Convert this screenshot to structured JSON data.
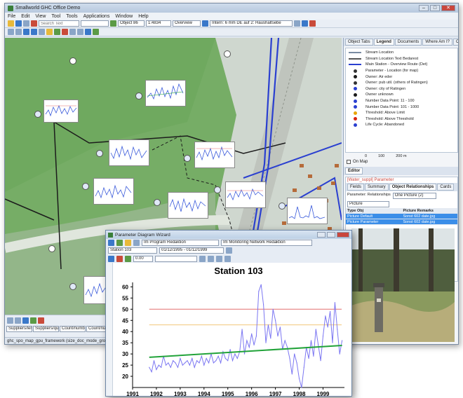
{
  "window": {
    "title": "Smallworld GHC Office Demo",
    "menu": [
      "File",
      "Edit",
      "View",
      "Tool",
      "Tools",
      "Applications",
      "Window",
      "Help"
    ],
    "search_placeholder": "Search Text",
    "combo_object": "Object 86",
    "combo_scale": "1:4834",
    "combo_mode": "Overview",
    "combo_trail": "Intern: 6 mm DE auf 2: Haushaltsebe"
  },
  "right_panel": {
    "tabs": [
      "Object Tabs",
      "Legend",
      "Documents",
      "Where Am I?",
      "CAD Tools"
    ],
    "legend_items": [
      {
        "label": "Stream Location",
        "color": "#7a8ca3",
        "shape": "line"
      },
      {
        "label": "Stream Location Text Bedarest",
        "color": "#555555",
        "shape": "line"
      },
      {
        "label": "Main Station - Overview Route (Det)",
        "color": "#2a3fd0",
        "shape": "line"
      },
      {
        "label": "Parameter - Location (for map)",
        "color": "#333333",
        "shape": "dot"
      },
      {
        "label": "Owner: Air eder",
        "color": "#1a1a1a",
        "shape": "dot"
      },
      {
        "label": "Owner: pub util. (others of Ratingen)",
        "color": "#333333",
        "shape": "dot"
      },
      {
        "label": "Owner: city of Ratingen",
        "color": "#2a3fd0",
        "shape": "dot"
      },
      {
        "label": "Owner unknown",
        "color": "#1a1a1a",
        "shape": "dot"
      },
      {
        "label": "Number Data Point: 11 - 100",
        "color": "#2a3fd0",
        "shape": "dot"
      },
      {
        "label": "Number Data Point: 101 - 1000",
        "color": "#2a3fd0",
        "shape": "dot"
      },
      {
        "label": "Threshold: Above Limit",
        "color": "#e8a400",
        "shape": "dot"
      },
      {
        "label": "Threshold: Above Threshold",
        "color": "#d9230f",
        "shape": "dot"
      },
      {
        "label": "Life Cycle: Abandoned",
        "color": "#2a3fd0",
        "shape": "dot"
      }
    ],
    "scale_bar": [
      "0",
      "100",
      "200 m"
    ],
    "on_map_label": "On Map",
    "editor_tab": "Editor",
    "editor_title": "[Water_suppl] Parameter",
    "editor_subtabs": [
      "Fields",
      "Summary",
      "Object Relationships",
      "Cards"
    ],
    "relationship_label": "Parameter: Relationships",
    "relationship_value": "One Picture (2)",
    "picture_combo": "Picture",
    "grid_headers": [
      "Type Obj",
      "Picture Remarks"
    ],
    "grid_rows": [
      {
        "a": "Picture Default",
        "b": "Sonst 602 date.jpg",
        "selected": true
      },
      {
        "a": "Picture Parameter",
        "b": "Sonst 602 date.jpg",
        "selected": true
      }
    ]
  },
  "statusbar": {
    "text": "ghc_spo_map_gpu_framework (size_doc_mode_group)"
  },
  "bottom_tools": {
    "fields": [
      "Suppliers/length",
      "Suppliers/quantity",
      "Count/number",
      "Count/number"
    ]
  },
  "dialog": {
    "title": "Parameter Diagram Wizard",
    "station_field": "Station 103",
    "date_range": "01/12/1995 - 01/12/1999",
    "program_label": "Im Program Redaktion",
    "network_label": "Im Monitoring Network Redaktion",
    "zoom_field": "0.00"
  },
  "chart_data": {
    "type": "line",
    "title": "Station 103",
    "xlabel": "",
    "ylabel": "",
    "xlim": [
      1991,
      1999.9
    ],
    "ylim": [
      15,
      62
    ],
    "yticks": [
      20,
      25,
      30,
      35,
      40,
      45,
      50,
      55,
      60
    ],
    "xticks": [
      1991,
      1992,
      1993,
      1994,
      1995,
      1996,
      1997,
      1998,
      1999
    ],
    "grid": false,
    "series": [
      {
        "color": "#7b76f2",
        "x": [
          1991.7,
          1991.8,
          1991.9,
          1992.0,
          1992.1,
          1992.2,
          1992.3,
          1992.4,
          1992.5,
          1992.6,
          1992.7,
          1992.8,
          1992.9,
          1993.0,
          1993.1,
          1993.2,
          1993.3,
          1993.4,
          1993.5,
          1993.6,
          1993.7,
          1993.8,
          1993.9,
          1994.0,
          1994.1,
          1994.2,
          1994.3,
          1994.4,
          1994.5,
          1994.6,
          1994.7,
          1994.8,
          1994.9,
          1995.0,
          1995.1,
          1995.2,
          1995.3,
          1995.4,
          1995.5,
          1995.6,
          1995.7,
          1995.8,
          1995.9,
          1996.0,
          1996.1,
          1996.2,
          1996.3,
          1996.4,
          1996.5,
          1996.6,
          1996.7,
          1996.8,
          1996.9,
          1997.0,
          1997.1,
          1997.2,
          1997.3,
          1997.4,
          1997.5,
          1997.6,
          1997.7,
          1997.8,
          1997.9,
          1998.0,
          1998.1,
          1998.2,
          1998.3,
          1998.4,
          1998.5,
          1998.6,
          1998.7,
          1998.8,
          1998.9,
          1999.0,
          1999.1,
          1999.2,
          1999.3,
          1999.4,
          1999.5,
          1999.6,
          1999.7,
          1999.8
        ],
        "y": [
          24,
          22,
          27,
          23,
          25,
          24,
          29,
          25,
          26,
          24,
          27,
          26,
          24,
          28,
          25,
          26,
          27,
          25,
          28,
          24,
          27,
          26,
          29,
          25,
          28,
          26,
          30,
          26,
          27,
          29,
          26,
          31,
          28,
          27,
          32,
          27,
          30,
          28,
          31,
          41,
          30,
          36,
          33,
          39,
          34,
          38,
          58,
          61,
          52,
          35,
          43,
          37,
          50,
          45,
          38,
          42,
          32,
          36,
          33,
          28,
          21,
          30,
          26,
          19,
          15,
          24,
          33,
          28,
          36,
          29,
          41,
          34,
          27,
          38,
          47,
          42,
          49,
          35,
          53,
          41,
          30,
          36
        ]
      }
    ],
    "reference_lines": [
      {
        "y": 50,
        "color": "#e26f6f"
      },
      {
        "y": 43,
        "color": "#f2c77a"
      }
    ],
    "trend": {
      "x": [
        1991.7,
        1999.8
      ],
      "y": [
        28.5,
        33.8
      ],
      "color": "#22a33a"
    }
  }
}
